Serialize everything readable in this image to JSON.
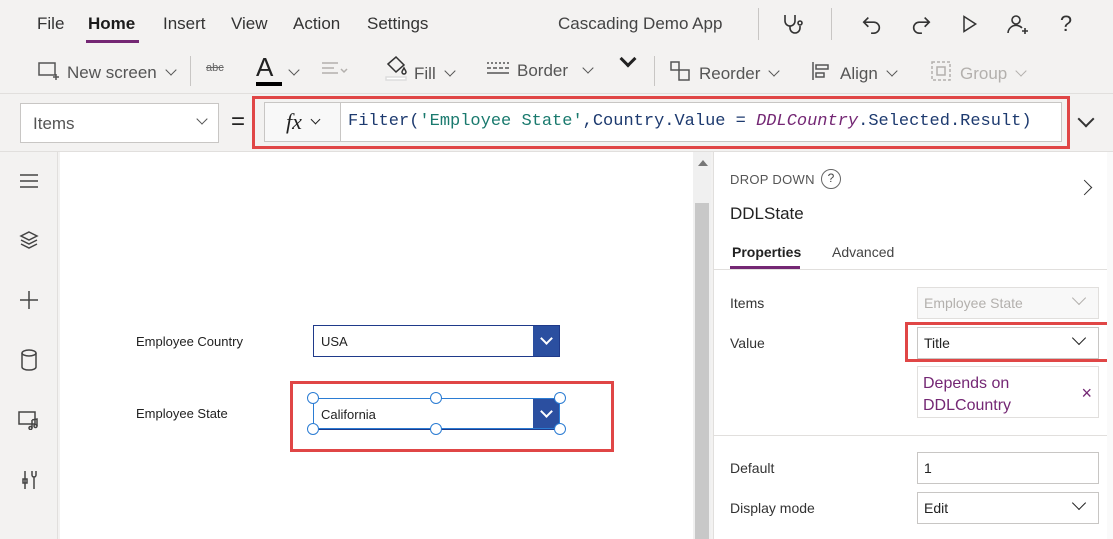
{
  "menu": {
    "items": [
      "File",
      "Home",
      "Insert",
      "View",
      "Action",
      "Settings"
    ],
    "active": "Home",
    "app_title": "Cascading Demo App",
    "icons": [
      "stethoscope-icon",
      "undo-icon",
      "redo-icon",
      "play-icon",
      "add-user-icon",
      "help-icon"
    ],
    "help_label": "?"
  },
  "toolbar": {
    "new_screen": "New screen",
    "strikethrough": "abc",
    "font_color": "A",
    "fill": "Fill",
    "border": "Border",
    "reorder": "Reorder",
    "align": "Align",
    "group": "Group"
  },
  "formula_bar": {
    "property": "Items",
    "equals": "=",
    "fx": "fx",
    "formula": {
      "prefix": "Filter(",
      "string": "'Employee State'",
      "middle": ",Country.Value = ",
      "control": "DDLCountry",
      "suffix": ".Selected.Result)"
    }
  },
  "canvas": {
    "country_label": "Employee Country",
    "country_value": "USA",
    "state_label": "Employee State",
    "state_value": "California"
  },
  "panel": {
    "type": "DROP DOWN",
    "help": "?",
    "name": "DDLState",
    "tabs": [
      "Properties",
      "Advanced"
    ],
    "items_label": "Items",
    "items_value": "Employee State",
    "value_label": "Value",
    "value_value": "Title",
    "depends_text": "Depends on DDLCountry",
    "depends_close": "×",
    "default_label": "Default",
    "default_value": "1",
    "display_mode_label": "Display mode",
    "display_mode_value": "Edit"
  },
  "colors": {
    "accent": "#742774",
    "highlight": "#e04646",
    "dropdown_blue": "#2b4fa0"
  }
}
